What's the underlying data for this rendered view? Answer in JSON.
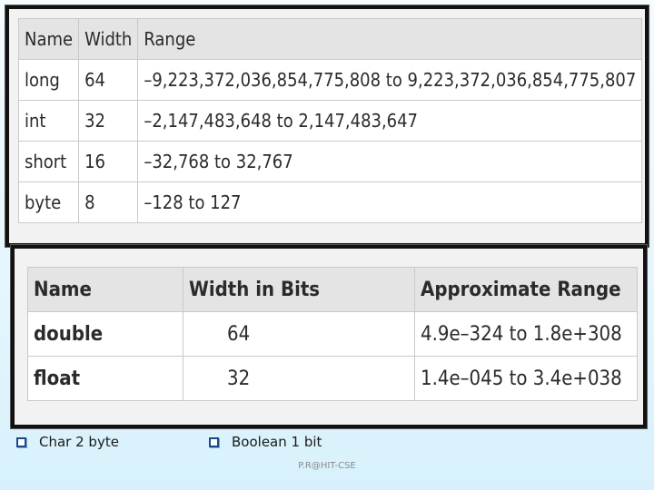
{
  "integer_table": {
    "headers": [
      "Name",
      "Width",
      "Range"
    ],
    "rows": [
      [
        "long",
        "64",
        "–9,223,372,036,854,775,808 to 9,223,372,036,854,775,807"
      ],
      [
        "int",
        "32",
        "–2,147,483,648 to 2,147,483,647"
      ],
      [
        "short",
        "16",
        "–32,768 to 32,767"
      ],
      [
        "byte",
        "8",
        "–128 to 127"
      ]
    ]
  },
  "float_table": {
    "headers": [
      "Name",
      "Width in Bits",
      "Approximate Range"
    ],
    "rows": [
      [
        "double",
        "64",
        "4.9e–324 to 1.8e+308"
      ],
      [
        "float",
        "32",
        "1.4e–045 to 3.4e+038"
      ]
    ]
  },
  "notes": [
    "Char 2 byte",
    "Boolean 1 bit"
  ],
  "footer": "P.R@HIT-CSE"
}
